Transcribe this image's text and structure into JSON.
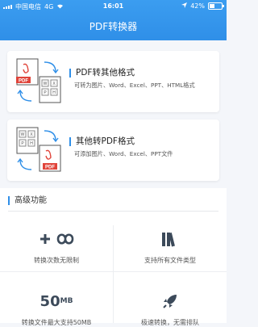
{
  "status_bar": {
    "carrier": "中国电信",
    "network": "4G",
    "time": "16:01",
    "battery": "42%",
    "battery_level": 0.42
  },
  "nav": {
    "title": "PDF转换器"
  },
  "cards": [
    {
      "title": "PDF转其他格式",
      "subtitle": "可转为图片、Word、Excel、PPT、HTML格式",
      "icon": "pdf-to-formats-illustration"
    },
    {
      "title": "其他转PDF格式",
      "subtitle": "可添加图片、Word、Excel、PPT文件",
      "icon": "formats-to-pdf-illustration"
    }
  ],
  "advanced": {
    "title": "高级功能",
    "features": [
      {
        "label": "转换次数无限制",
        "icon": "plus-infinity-icon"
      },
      {
        "label": "支持所有文件类型",
        "icon": "books-icon"
      },
      {
        "label": "转换文件最大支持50MB",
        "icon": "50mb-icon",
        "icon_text": "50",
        "icon_unit": "MB"
      },
      {
        "label": "极速转换，无需排队",
        "icon": "rocket-icon"
      }
    ]
  },
  "colors": {
    "primary": "#2f8fe8",
    "pdf_red": "#e0443a",
    "icon_dark": "#3c4a5a"
  }
}
